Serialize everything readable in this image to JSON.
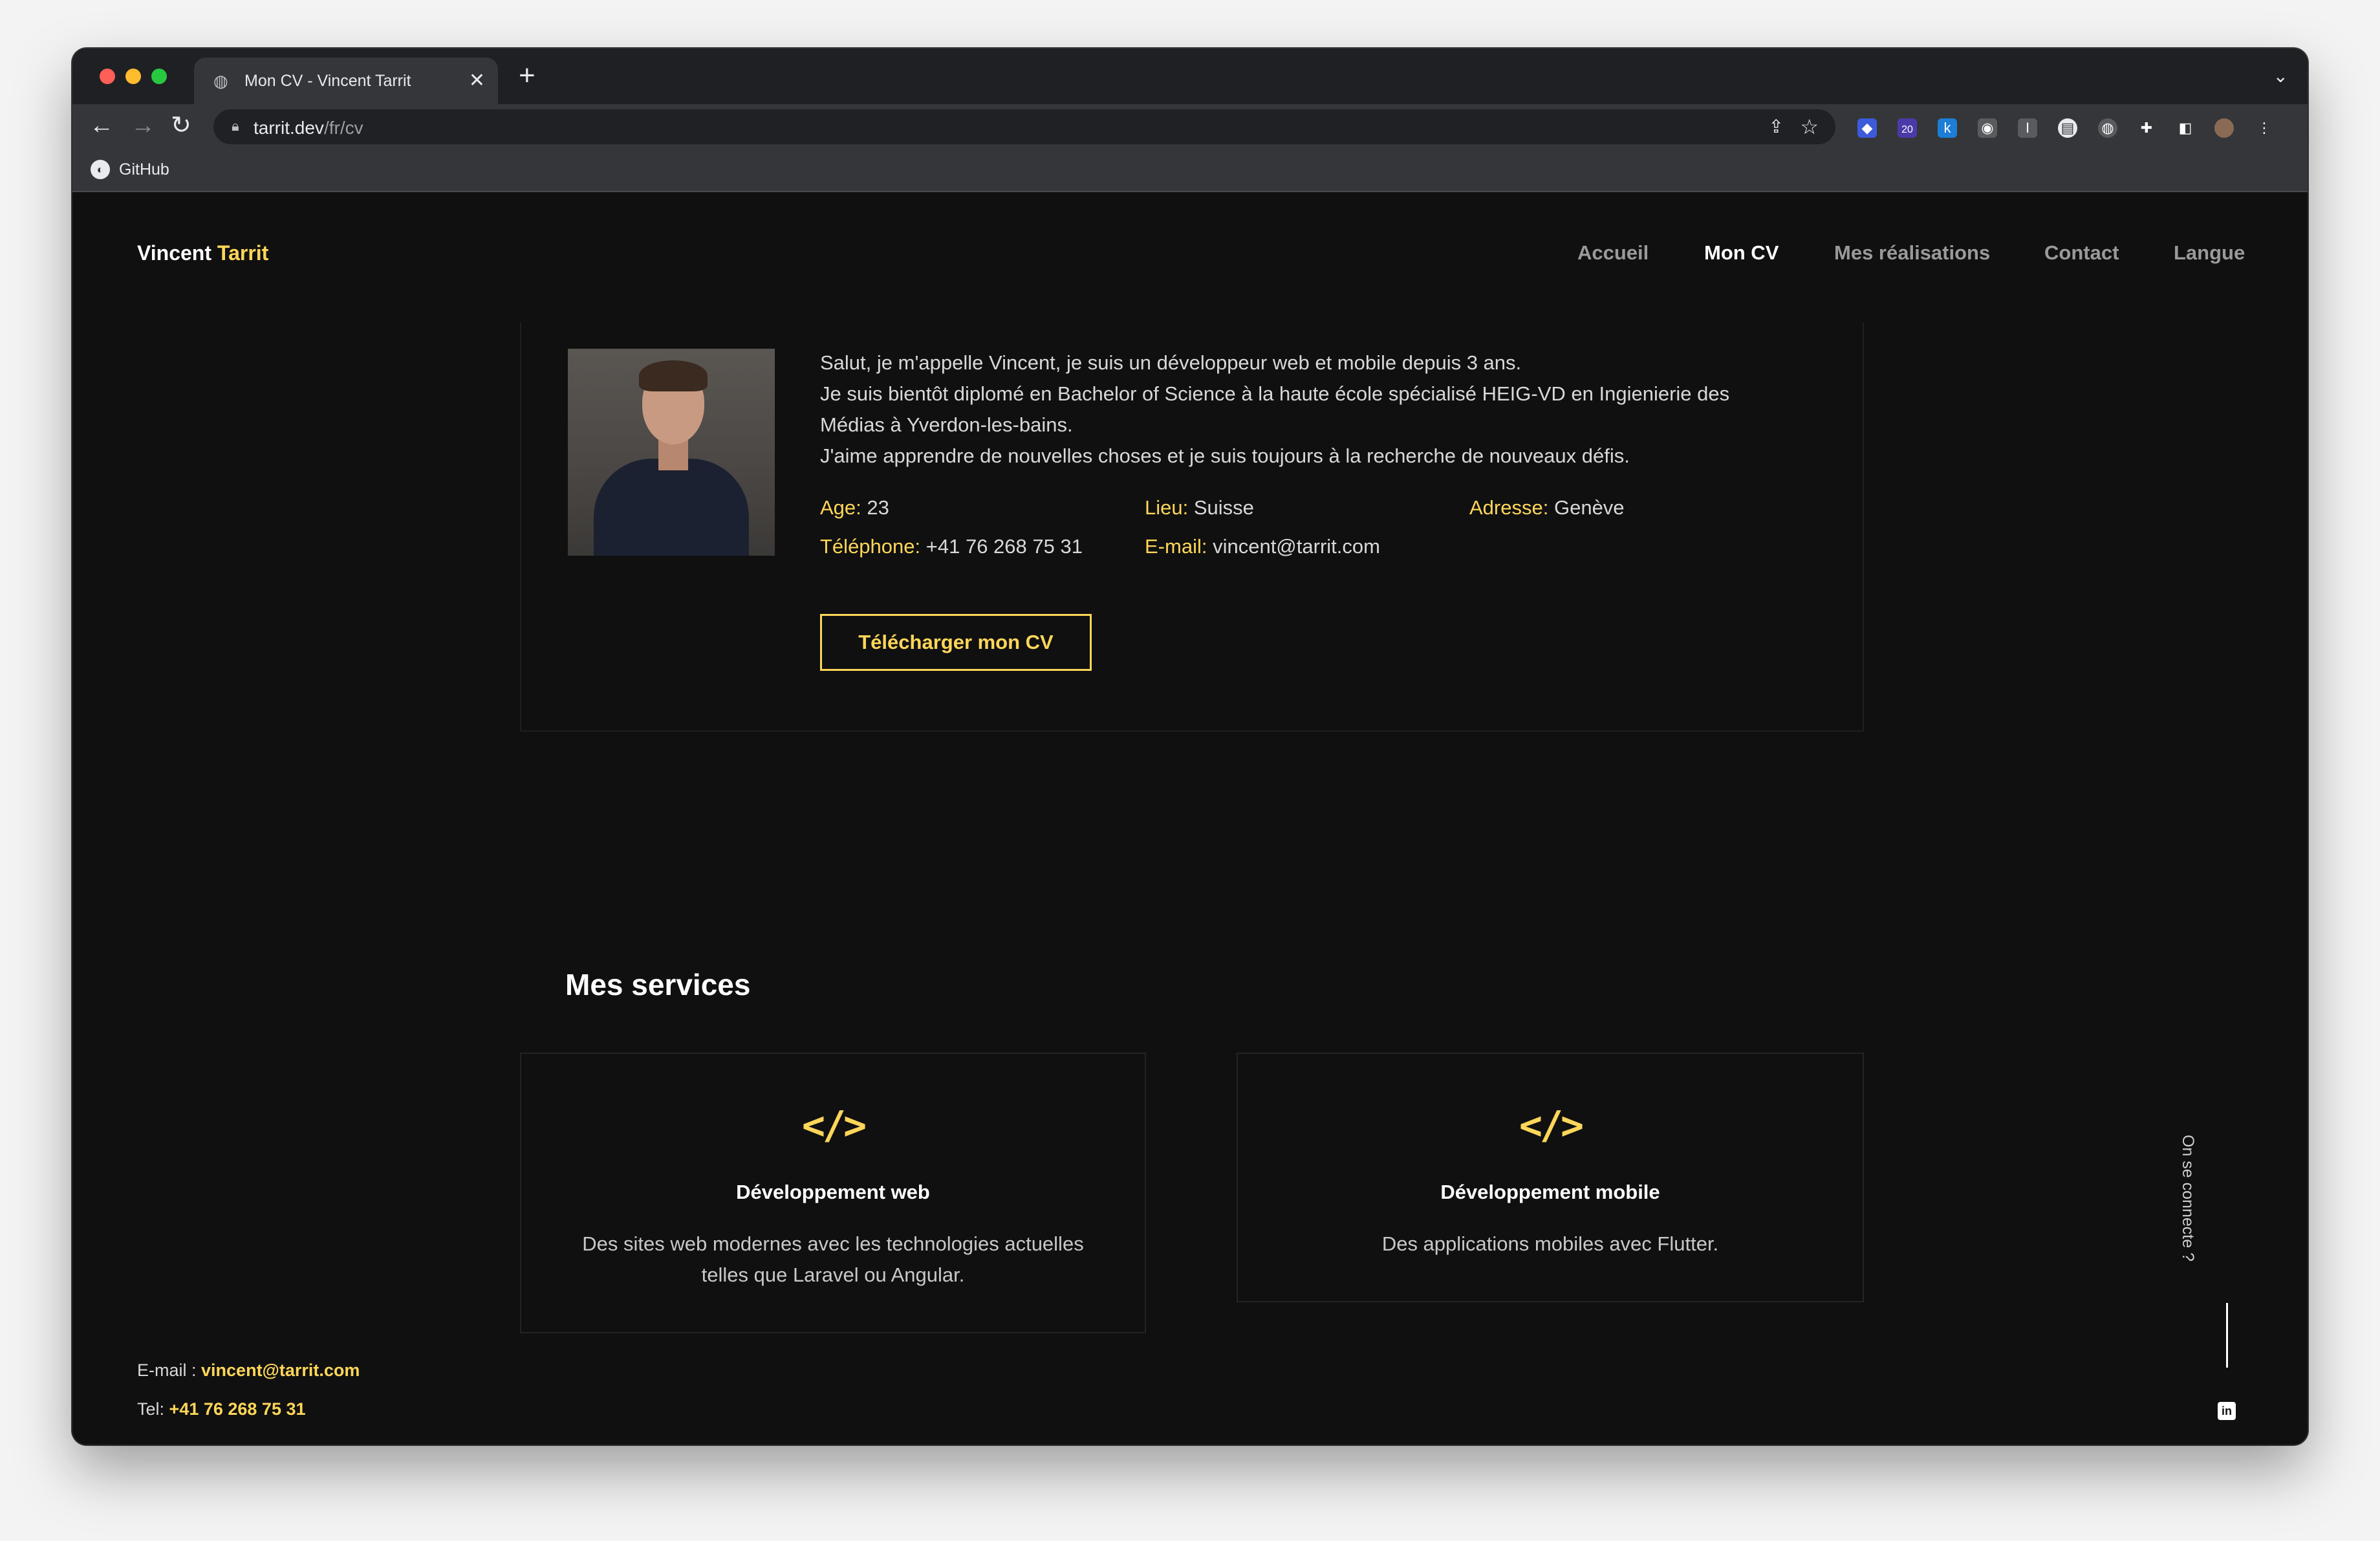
{
  "browser": {
    "tab_title": "Mon CV - Vincent Tarrit",
    "new_tab": "+",
    "tab_close": "✕",
    "url_host": "tarrit.dev",
    "url_path": "/fr/cv",
    "bookmarks": [
      {
        "label": "GitHub"
      }
    ],
    "extension_badge": "20"
  },
  "site": {
    "brand_first": "Vincent",
    "brand_last": "Tarrit",
    "nav": [
      {
        "label": "Accueil",
        "active": false
      },
      {
        "label": "Mon CV",
        "active": true
      },
      {
        "label": "Mes réalisations",
        "active": false
      },
      {
        "label": "Contact",
        "active": false
      },
      {
        "label": "Langue",
        "active": false
      }
    ]
  },
  "about": {
    "intro_lines": [
      "Salut, je m'appelle Vincent, je suis un développeur web et mobile depuis 3 ans.",
      "Je suis bientôt diplomé en Bachelor of Science à la haute école spécialisé HEIG-VD en Ingienierie des Médias à Yverdon-les-bains.",
      "J'aime apprendre de nouvelles choses et je suis toujours à la recherche de nouveaux défis."
    ],
    "info": [
      {
        "key": "Age:",
        "value": "23"
      },
      {
        "key": "Lieu:",
        "value": "Suisse"
      },
      {
        "key": "Adresse:",
        "value": "Genève"
      },
      {
        "key": "Téléphone:",
        "value": "+41 76 268 75 31"
      },
      {
        "key": "E-mail:",
        "value": "vincent@tarrit.com"
      }
    ],
    "download_button": "Télécharger mon CV"
  },
  "services": {
    "title": "Mes services",
    "items": [
      {
        "icon": "code-icon",
        "symbol": "</>",
        "title": "Développement web",
        "description": "Des sites web modernes avec les technologies actuelles telles que Laravel ou Angular."
      },
      {
        "icon": "code-icon",
        "symbol": "</>",
        "title": "Développement mobile",
        "description": "Des applications mobiles avec Flutter."
      }
    ]
  },
  "footer": {
    "email_label": "E-mail :",
    "email_value": "vincent@tarrit.com",
    "tel_label": "Tel:",
    "tel_value": "+41 76 268 75 31",
    "social_label": "On se connecte ?",
    "linkedin": "in"
  },
  "colors": {
    "accent": "#ffd659",
    "background": "#101010",
    "border": "#242424"
  }
}
